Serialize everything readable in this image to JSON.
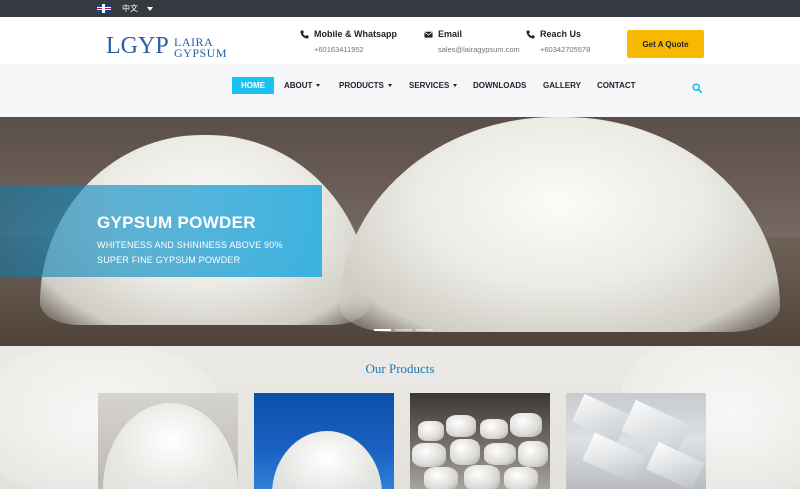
{
  "topbar": {
    "language": "中文"
  },
  "header": {
    "logo": {
      "mark": "LGYP",
      "line1": "LAIRA",
      "line2": "GYPSUM"
    },
    "contacts": [
      {
        "title": "Mobile & Whatsapp",
        "value": "+60163411952",
        "icon": "phone-icon"
      },
      {
        "title": "Email",
        "value": "sales@lairagypsum.com",
        "icon": "envelope-icon"
      },
      {
        "title": "Reach Us",
        "value": "+60342705578",
        "icon": "phone-icon"
      }
    ],
    "quote_button": "Get A Quote",
    "accent_color": "#f9b800"
  },
  "nav": {
    "items": [
      {
        "label": "HOME",
        "active": true
      },
      {
        "label": "ABOUT",
        "dropdown": true
      },
      {
        "label": "PRODUCTS",
        "dropdown": true
      },
      {
        "label": "SERVICES",
        "dropdown": true
      },
      {
        "label": "DOWNLOADS"
      },
      {
        "label": "GALLERY"
      },
      {
        "label": "CONTACT"
      }
    ],
    "active_color": "#19c2f0"
  },
  "hero": {
    "heading": "GYPSUM POWDER",
    "line1": "WHITENESS AND SHININESS ABOVE 90%",
    "line2": "SUPER FINE GYPSUM POWDER",
    "slides": 3,
    "active_slide": 1
  },
  "products": {
    "title": "Our Products",
    "title_color": "#1a78b5"
  }
}
